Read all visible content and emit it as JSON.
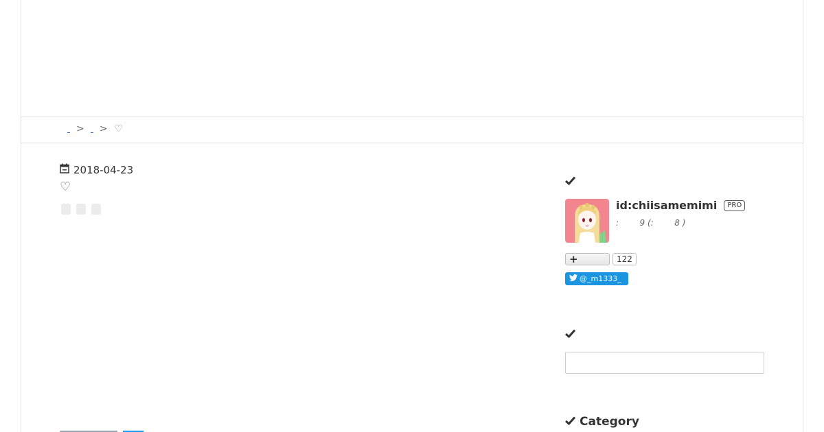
{
  "breadcrumb": {
    "separator": ">",
    "current": "♡"
  },
  "entry": {
    "date": "2018-04-23",
    "title": "♡"
  },
  "profile": {
    "id": "id:chiisamemimi",
    "badge": "PRO",
    "meta": ":        9 (:        8 )",
    "follower_count": "122",
    "twitter_handle": "@_m1333_"
  },
  "sidebar": {
    "category_title": "Category"
  },
  "search": {
    "placeholder": ""
  },
  "colors": {
    "twitter": "#1b95e0",
    "link": "#2a6ad5",
    "border": "#dcdcdc"
  }
}
